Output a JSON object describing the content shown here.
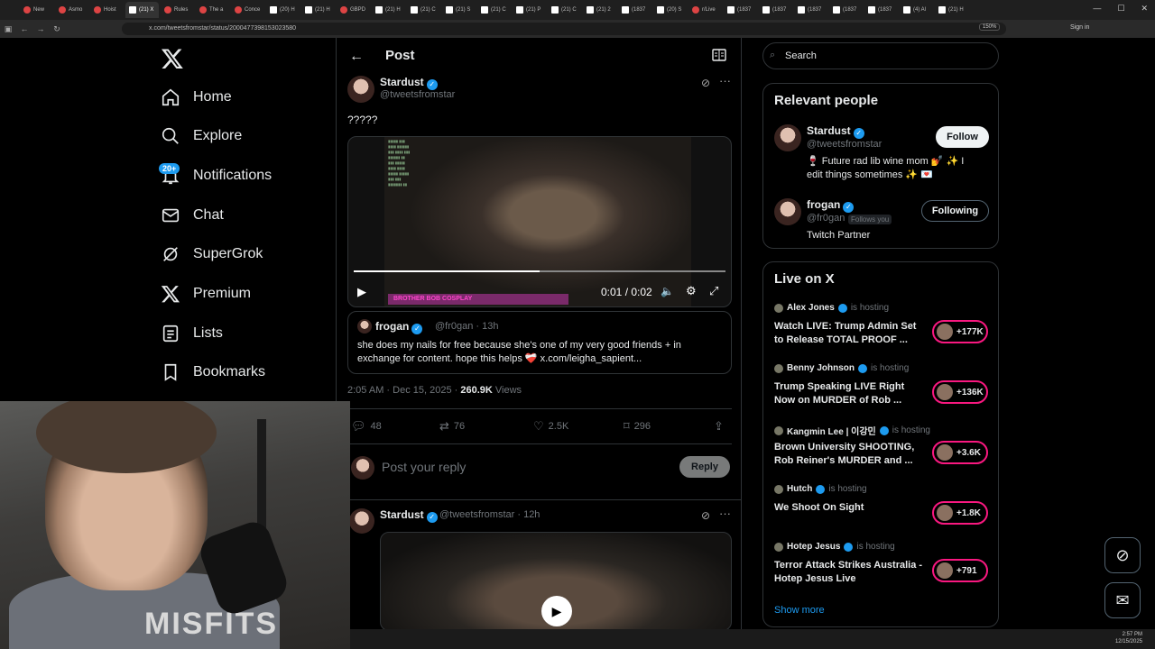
{
  "browser": {
    "tabs": [
      {
        "label": "New"
      },
      {
        "label": "Asmo"
      },
      {
        "label": "Hoist"
      },
      {
        "label": "(21) X",
        "active": true
      },
      {
        "label": "Rules"
      },
      {
        "label": "The a"
      },
      {
        "label": "Conce"
      },
      {
        "label": "(20) H"
      },
      {
        "label": "(21) H"
      },
      {
        "label": "GBPD"
      },
      {
        "label": "(21) H"
      },
      {
        "label": "(21) C"
      },
      {
        "label": "(21) S"
      },
      {
        "label": "(21) C"
      },
      {
        "label": "(21) P"
      },
      {
        "label": "(21) C"
      },
      {
        "label": "(21) 2"
      },
      {
        "label": "(1837"
      },
      {
        "label": "(20) S"
      },
      {
        "label": "r/Live"
      },
      {
        "label": "(1837"
      },
      {
        "label": "(1837"
      },
      {
        "label": "(1837"
      },
      {
        "label": "(1837"
      },
      {
        "label": "(1837"
      },
      {
        "label": "(4) Al"
      },
      {
        "label": "(21) H"
      }
    ],
    "url": "x.com/tweetsfromstar/status/2000477398153023580",
    "zoom": "150%",
    "signin": "Sign in"
  },
  "nav": {
    "items": [
      {
        "label": "Home",
        "icon": "home-icon"
      },
      {
        "label": "Explore",
        "icon": "search-icon"
      },
      {
        "label": "Notifications",
        "icon": "bell-icon"
      },
      {
        "label": "Chat",
        "icon": "mail-icon"
      },
      {
        "label": "SuperGrok",
        "icon": "grok-icon"
      },
      {
        "label": "Premium",
        "icon": "x-icon"
      },
      {
        "label": "Lists",
        "icon": "list-icon"
      },
      {
        "label": "Bookmarks",
        "icon": "bookmark-icon"
      }
    ],
    "notif_badge": "20+"
  },
  "post": {
    "header_title": "Post",
    "author_name": "Stardust",
    "author_handle": "@tweetsfromstar",
    "text": "?????",
    "video": {
      "time": "0:01 / 0:02",
      "banner": "BROTHER BOB COSPLAY",
      "progress": 0.5
    },
    "quote": {
      "name": "frogan",
      "handle": "@fr0gan · 13h",
      "text": "she does my nails for free because she's one of my very good friends + in exchange for content. hope this helps ❤️‍🩹 x.com/leigha_sapient..."
    },
    "timestamp": "2:05 AM · Dec 15, 2025 · ",
    "views_count": "260.9K",
    "views_label": " Views",
    "actions": {
      "replies": "48",
      "reposts": "76",
      "likes": "2.5K",
      "bookmarks": "296"
    },
    "reply_placeholder": "Post your reply",
    "reply_button": "Reply"
  },
  "reply_tweet": {
    "name": "Stardust",
    "handle": "@tweetsfromstar · 12h"
  },
  "sidebar": {
    "search_placeholder": "Search",
    "relevant": {
      "title": "Relevant people",
      "people": [
        {
          "name": "Stardust",
          "handle": "@tweetsfromstar",
          "bio": "🍷 Future rad lib wine mom 💅 ✨ I edit things sometimes ✨ 💌",
          "button": "Follow"
        },
        {
          "name": "frogan",
          "handle": "@fr0gan",
          "follows_you": "Follows you",
          "bio": "Twitch Partner",
          "button": "Following"
        }
      ]
    },
    "live": {
      "title": "Live on X",
      "items": [
        {
          "host": "Alex Jones",
          "status": "is hosting",
          "title": "Watch LIVE: Trump Admin Set to Release TOTAL PROOF ...",
          "count": "+177K"
        },
        {
          "host": "Benny Johnson",
          "status": "is hosting",
          "title": "Trump Speaking LIVE Right Now on MURDER of Rob ...",
          "count": "+136K"
        },
        {
          "host": "Kangmin Lee | 이강민",
          "status": "is hosting",
          "title": "Brown University SHOOTING, Rob Reiner's MURDER and ...",
          "count": "+3.6K"
        },
        {
          "host": "Hutch",
          "status": "is hosting",
          "title": "We Shoot On Sight",
          "count": "+1.8K"
        },
        {
          "host": "Hotep Jesus",
          "status": "is hosting",
          "title": "Terror Attack Strikes Australia - Hotep Jesus Live",
          "count": "+791"
        }
      ],
      "show_more": "Show more"
    }
  },
  "webcam": {
    "shirt_text": "MISFITS"
  },
  "taskbar": {
    "time": "2:57 PM",
    "date": "12/15/2025"
  }
}
